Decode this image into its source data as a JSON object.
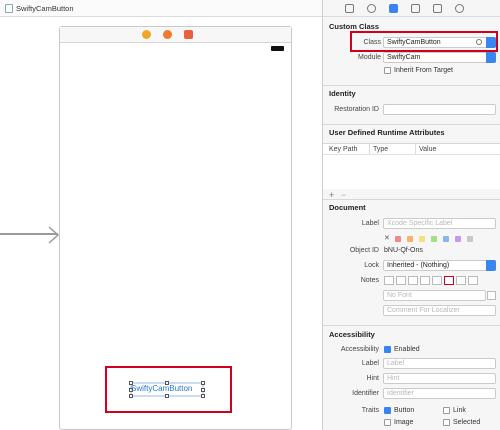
{
  "jumpbar": {
    "title": "SwiftyCamButton"
  },
  "canvas": {
    "button_title": "SwiftyCamButton"
  },
  "inspector": {
    "custom_class": {
      "header": "Custom Class",
      "class_label": "Class",
      "class_value": "SwiftyCamButton",
      "module_label": "Module",
      "module_value": "SwiftyCam",
      "inherit_label": "Inherit From Target"
    },
    "identity": {
      "header": "Identity",
      "restoration_label": "Restoration ID",
      "restoration_value": ""
    },
    "udra": {
      "header": "User Defined Runtime Attributes",
      "col_keypath": "Key Path",
      "col_type": "Type",
      "col_value": "Value",
      "add": "+",
      "remove": "−"
    },
    "document": {
      "header": "Document",
      "label_label": "Label",
      "label_placeholder": "Xcode Specific Label",
      "clear_glyph": "✕",
      "swatch_colors": [
        "#f08a8a",
        "#f7b36b",
        "#f5e07a",
        "#a6dc8a",
        "#88b7f0",
        "#c49af0",
        "#c8c8c8"
      ],
      "object_id_label": "Object ID",
      "object_id_value": "bNU-Qf-Ons",
      "lock_label": "Lock",
      "lock_value": "Inherited - (Nothing)",
      "notes_label": "Notes",
      "font_placeholder": "No Font",
      "comment_placeholder": "Comment For Localizer"
    },
    "accessibility": {
      "header": "Accessibility",
      "accessibility_label": "Accessibility",
      "enabled_label": "Enabled",
      "label_label": "Label",
      "label_placeholder": "Label",
      "hint_label": "Hint",
      "hint_placeholder": "Hint",
      "identifier_label": "Identifier",
      "identifier_placeholder": "Identifier",
      "traits_label": "Traits",
      "trait_button": "Button",
      "trait_link": "Link",
      "trait_image": "Image",
      "trait_selected": "Selected"
    }
  }
}
